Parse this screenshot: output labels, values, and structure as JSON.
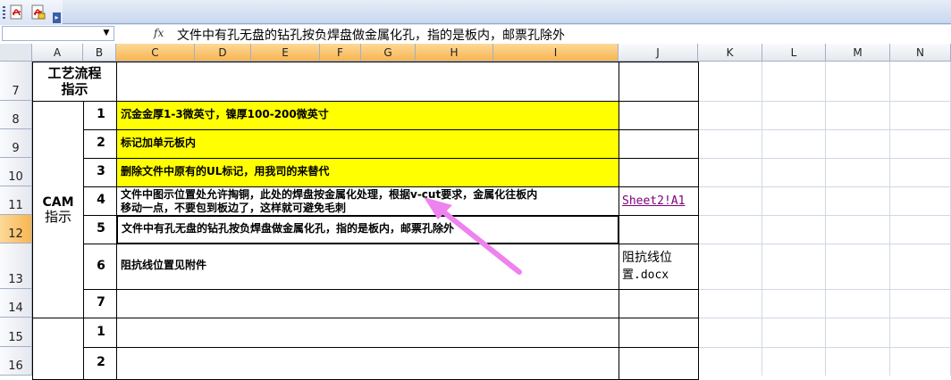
{
  "toolbar": {
    "buttons": [
      "pdf-icon",
      "pdf-options-icon"
    ],
    "overflow_label": "▸"
  },
  "formula_bar": {
    "name_box": "",
    "fx_label": "fx",
    "formula": "文件中有孔无盘的钻孔按负焊盘做金属化孔，指的是板内，邮票孔除外"
  },
  "columns": [
    "A",
    "B",
    "C",
    "D",
    "E",
    "F",
    "G",
    "H",
    "I",
    "J",
    "K",
    "L",
    "M",
    "N"
  ],
  "selected_column_letters": [
    "C",
    "D",
    "E",
    "F",
    "G",
    "H",
    "I"
  ],
  "rows": [
    "7",
    "8",
    "9",
    "10",
    "11",
    "12",
    "13",
    "14",
    "15",
    "16"
  ],
  "selected_row": "12",
  "sheet": {
    "header_label_line1": "工艺流程",
    "header_label_line2": "指示",
    "cam_label_line1": "CAM",
    "cam_label_line2": "指示",
    "steps": [
      {
        "num": "1",
        "text": "沉金金厚1-3微英寸，镍厚100-200微英寸"
      },
      {
        "num": "2",
        "text": "标记加单元板内"
      },
      {
        "num": "3",
        "text": "删除文件中原有的UL标记，用我司的来替代"
      },
      {
        "num": "4",
        "text_line1": "文件中图示位置处允许掏铜，此处的焊盘按金属化处理，根据v-cut要求，金属化往板内",
        "text_line2": "移动一点，不要包到板边了，这样就可避免毛刺"
      },
      {
        "num": "5",
        "text": "文件中有孔无盘的钻孔按负焊盘做金属化孔，指的是板内，邮票孔除外"
      },
      {
        "num": "6",
        "text": "阻抗线位置见附件"
      },
      {
        "num": "7",
        "text": ""
      }
    ],
    "next_block": [
      {
        "num": "1"
      },
      {
        "num": "2"
      }
    ],
    "link_cell": "Sheet2!A1",
    "attachment_line1": "阻抗线位",
    "attachment_line2": "置.docx"
  },
  "colors": {
    "highlight": "#ffff00",
    "selected_header": "#f8b550",
    "link": "#800080",
    "annotation_arrow": "#ee82ee"
  }
}
